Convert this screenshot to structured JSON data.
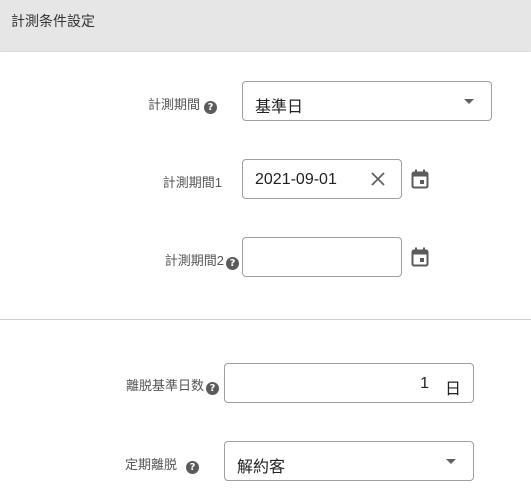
{
  "header": {
    "title": "計測条件設定"
  },
  "period": {
    "label": "計測期間",
    "value": "基準日"
  },
  "period1": {
    "label": "計測期間1",
    "value": "2021-09-01"
  },
  "period2": {
    "label": "計測期間2",
    "value": ""
  },
  "churn_days": {
    "label": "離脱基準日数",
    "value": "1",
    "unit": "日"
  },
  "regular_churn": {
    "label": "定期離脱",
    "value": "解約客"
  },
  "icons": {
    "help": "help-circle-icon",
    "dropdown": "caret-down-icon",
    "clear": "close-icon",
    "calendar": "calendar-icon"
  },
  "colors": {
    "header_bg": "#e6e6e6",
    "border": "#9e9e9e",
    "icon": "#5b5b5b"
  }
}
